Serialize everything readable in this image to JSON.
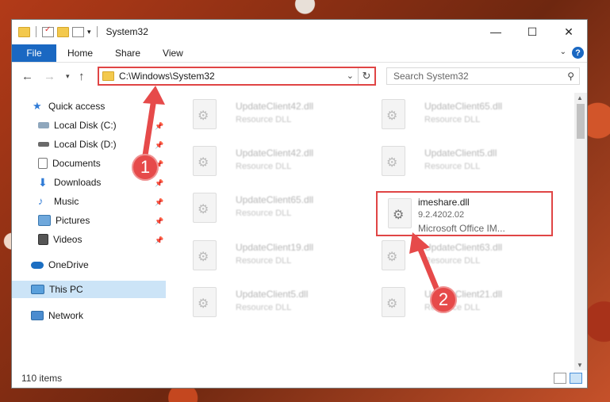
{
  "window": {
    "title": "System32"
  },
  "ribbon": {
    "tabs": [
      "File",
      "Home",
      "Share",
      "View"
    ],
    "help": "?"
  },
  "address": {
    "path": "C:\\Windows\\System32"
  },
  "search": {
    "placeholder": "Search System32"
  },
  "sidebar": {
    "quick_access": "Quick access",
    "items": [
      "Local Disk (C:)",
      "Local Disk (D:)",
      "Documents",
      "Downloads",
      "Music",
      "Pictures",
      "Videos"
    ],
    "onedrive": "OneDrive",
    "thispc": "This PC",
    "network": "Network"
  },
  "files": [
    {
      "name": "UpdateClient42.dll",
      "type": "Resource DLL"
    },
    {
      "name": "UpdateClient65.dll",
      "type": "Resource DLL"
    },
    {
      "name": "UpdateClient42.dll",
      "type": "Resource DLL"
    },
    {
      "name": "UpdateClient5.dll",
      "type": "Resource DLL"
    },
    {
      "name": "UpdateClient65.dll",
      "type": "Resource DLL"
    },
    {
      "name": "UpdateClient19.dll",
      "type": "Resource DLL"
    },
    {
      "name": "UpdateClient63.dll",
      "type": "Resource DLL"
    },
    {
      "name": "UpdateClient5.dll",
      "type": "Resource DLL"
    },
    {
      "name": "UpdateClient21.dll",
      "type": "Resource DLL"
    }
  ],
  "selected_file": {
    "name": "imeshare.dll",
    "version": "9.2.4202.02",
    "desc": "Microsoft Office IM..."
  },
  "status": {
    "count": "110 items"
  },
  "annotations": {
    "badge1": "1",
    "badge2": "2",
    "highlight_color": "#e04545"
  }
}
